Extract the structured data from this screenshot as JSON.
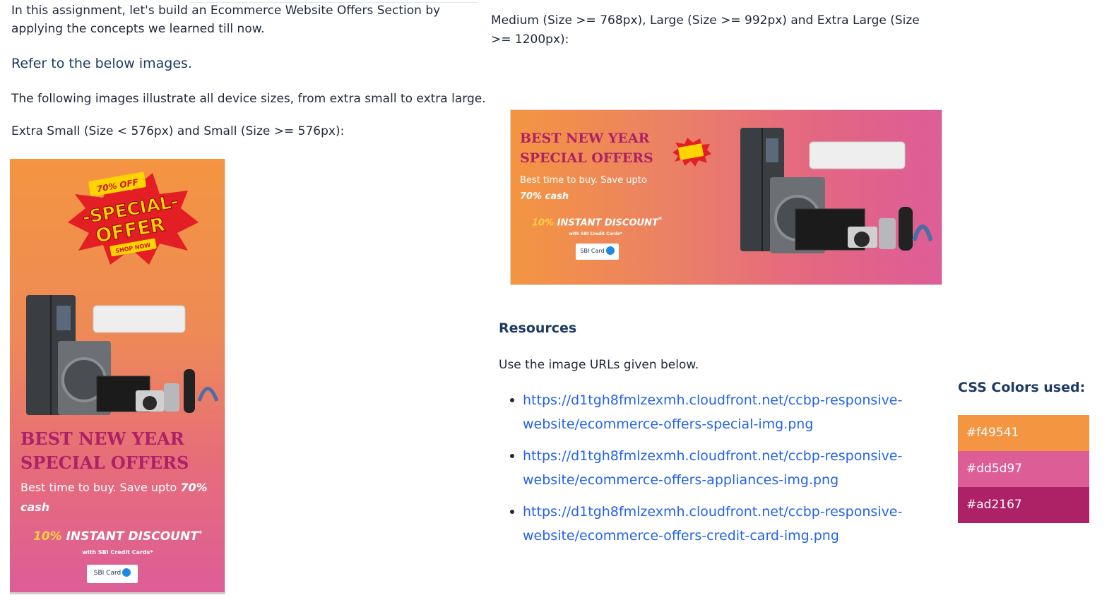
{
  "intro": "In this assignment, let's build an Ecommerce Website Offers Section by applying the concepts we learned till now.",
  "refer_heading": "Refer to the below images.",
  "illustrate_text": "The following images illustrate all device sizes, from extra small to extra large.",
  "xs_label": "Extra Small (Size < 576px) and Small (Size >= 576px):",
  "md_label": "Medium (Size >= 768px), Large (Size >= 992px) and Extra Large (Size >= 1200px):",
  "banner": {
    "badge_top": "70% OFF",
    "badge_main_1": "-SPECIAL-",
    "badge_main_2": "OFFER",
    "badge_bottom": "SHOP NOW",
    "title_line1": "BEST NEW YEAR",
    "title_line2": "SPECIAL OFFERS",
    "sub_text": "Best time to buy. Save upto ",
    "sub_bold": "70% cash",
    "discount_pct": "10%",
    "discount_text": " INSTANT DISCOUNT",
    "discount_star": "*",
    "with_text": "with SBI Credit Cards*",
    "card_label": "SBI Card"
  },
  "resources_heading": "Resources",
  "use_text": "Use the image URLs given below.",
  "links": [
    {
      "line1": "https://d1tgh8fmlzexmh.cloudfront.net/ccbp-responsive-",
      "line2": "website/ecommerce-offers-special-img.png"
    },
    {
      "line1": "https://d1tgh8fmlzexmh.cloudfront.net/ccbp-responsive-",
      "line2": "website/ecommerce-offers-appliances-img.png"
    },
    {
      "line1": "https://d1tgh8fmlzexmh.cloudfront.net/ccbp-responsive-",
      "line2": "website/ecommerce-offers-credit-card-img.png"
    }
  ],
  "css_colors_heading": "CSS Colors used:",
  "colors": [
    {
      "label": "#f49541",
      "hex": "#f49541"
    },
    {
      "label": "#dd5d97",
      "hex": "#dd5d97"
    },
    {
      "label": "#ad2167",
      "hex": "#ad2167"
    }
  ]
}
